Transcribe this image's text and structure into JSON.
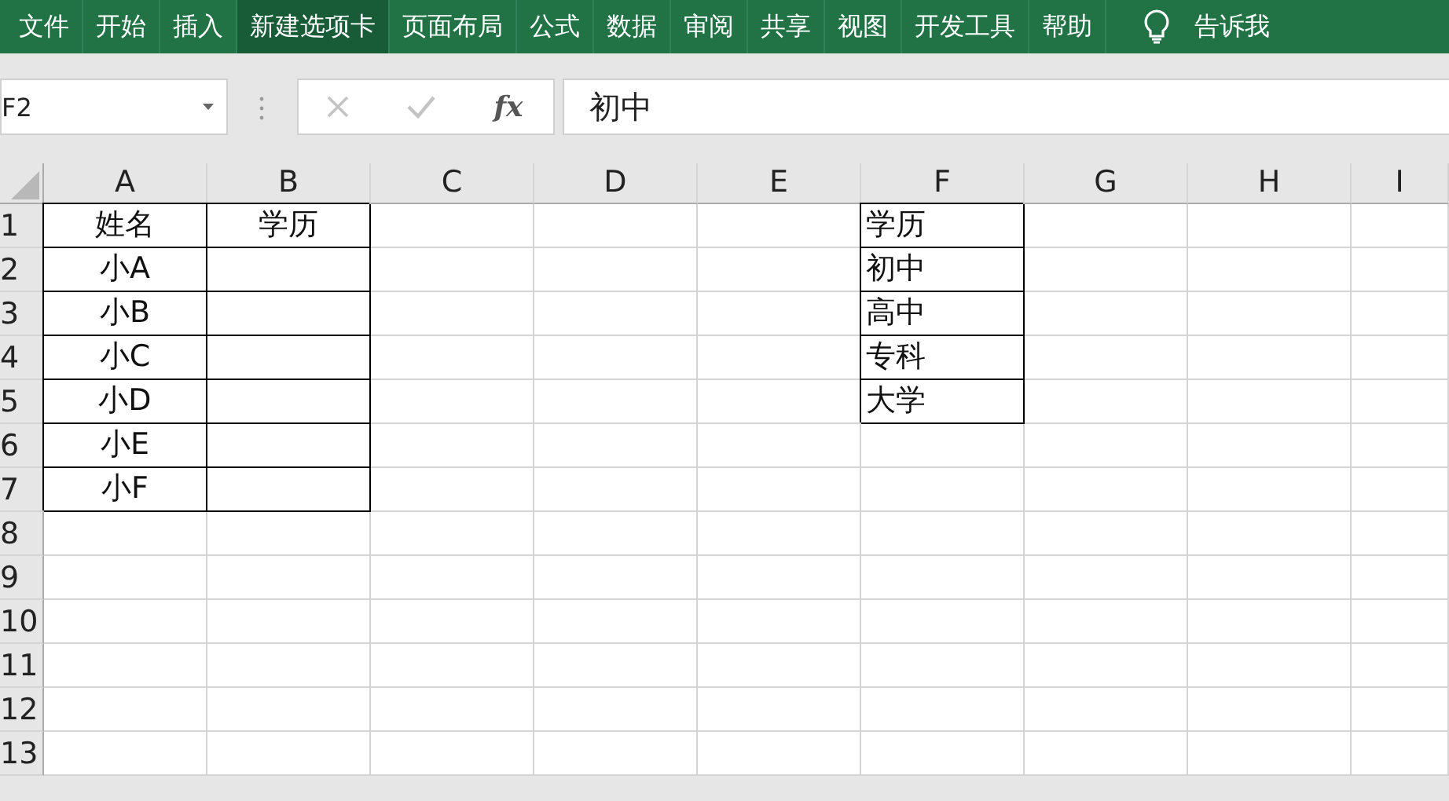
{
  "ribbon": {
    "tabs": [
      {
        "label": "文件",
        "selected": false
      },
      {
        "label": "开始",
        "selected": false
      },
      {
        "label": "插入",
        "selected": false
      },
      {
        "label": "新建选项卡",
        "selected": true
      },
      {
        "label": "页面布局",
        "selected": false
      },
      {
        "label": "公式",
        "selected": false
      },
      {
        "label": "数据",
        "selected": false
      },
      {
        "label": "审阅",
        "selected": false
      },
      {
        "label": "共享",
        "selected": false
      },
      {
        "label": "视图",
        "selected": false
      },
      {
        "label": "开发工具",
        "selected": false
      },
      {
        "label": "帮助",
        "selected": false
      }
    ],
    "tell_me": "告诉我"
  },
  "formula_bar": {
    "name_box": "F2",
    "function_label": "fx",
    "value": "初中",
    "cancel_disabled": true,
    "enter_disabled": true
  },
  "sheet": {
    "columns": [
      "A",
      "B",
      "C",
      "D",
      "E",
      "F",
      "G",
      "H",
      "I"
    ],
    "rows": [
      {
        "number": "1",
        "cells": {
          "A": {
            "text": "姓名",
            "centered": true,
            "bordered": true
          },
          "B": {
            "text": "学历",
            "centered": true,
            "bordered": true
          },
          "F": {
            "text": "学历",
            "centered": false,
            "bordered": true
          }
        }
      },
      {
        "number": "2",
        "cells": {
          "A": {
            "text": "小A",
            "centered": true,
            "bordered": true
          },
          "B": {
            "bordered": true
          },
          "F": {
            "text": "初中",
            "centered": false,
            "bordered": true
          }
        }
      },
      {
        "number": "3",
        "cells": {
          "A": {
            "text": "小B",
            "centered": true,
            "bordered": true
          },
          "B": {
            "bordered": true
          },
          "F": {
            "text": "高中",
            "centered": false,
            "bordered": true
          }
        }
      },
      {
        "number": "4",
        "cells": {
          "A": {
            "text": "小C",
            "centered": true,
            "bordered": true
          },
          "B": {
            "bordered": true
          },
          "F": {
            "text": "专科",
            "centered": false,
            "bordered": true
          }
        }
      },
      {
        "number": "5",
        "cells": {
          "A": {
            "text": "小D",
            "centered": true,
            "bordered": true
          },
          "B": {
            "bordered": true
          },
          "F": {
            "text": "大学",
            "centered": false,
            "bordered": true
          }
        }
      },
      {
        "number": "6",
        "cells": {
          "A": {
            "text": "小E",
            "centered": true,
            "bordered": true
          },
          "B": {
            "bordered": true
          }
        }
      },
      {
        "number": "7",
        "cells": {
          "A": {
            "text": "小F",
            "centered": true,
            "bordered": true
          },
          "B": {
            "bordered": true
          }
        }
      },
      {
        "number": "8"
      },
      {
        "number": "9"
      },
      {
        "number": "10"
      },
      {
        "number": "11"
      },
      {
        "number": "12"
      },
      {
        "number": "13"
      }
    ]
  }
}
